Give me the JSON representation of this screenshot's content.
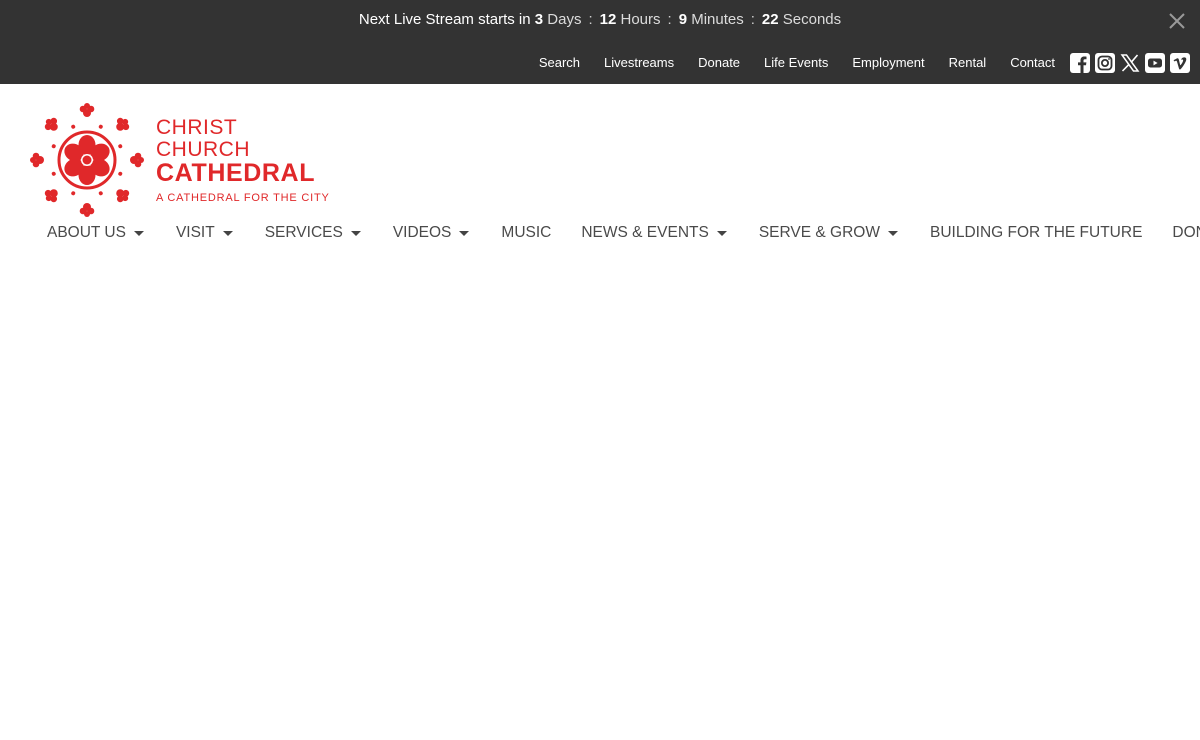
{
  "countdown": {
    "lead": "Next Live Stream starts in",
    "days": "3",
    "days_label": "Days",
    "hours": "12",
    "hours_label": "Hours",
    "minutes": "9",
    "minutes_label": "Minutes",
    "seconds": "22",
    "seconds_label": "Seconds",
    "separator": ":"
  },
  "utility_nav": [
    "Search",
    "Livestreams",
    "Donate",
    "Life Events",
    "Employment",
    "Rental",
    "Contact"
  ],
  "social_icons": [
    "facebook-icon",
    "instagram-icon",
    "x-icon",
    "youtube-icon",
    "vimeo-icon"
  ],
  "logo": {
    "line1": "CHRIST CHURCH",
    "line2": "CATHEDRAL",
    "line3": "A CATHEDRAL FOR THE CITY",
    "brand_color": "#e0282a"
  },
  "main_nav": [
    {
      "label": "ABOUT US",
      "dropdown": true
    },
    {
      "label": "VISIT",
      "dropdown": true
    },
    {
      "label": "SERVICES",
      "dropdown": true
    },
    {
      "label": "VIDEOS",
      "dropdown": true
    },
    {
      "label": "MUSIC",
      "dropdown": false
    },
    {
      "label": "NEWS & EVENTS",
      "dropdown": true
    },
    {
      "label": "SERVE & GROW",
      "dropdown": true
    },
    {
      "label": "BUILDING FOR THE FUTURE",
      "dropdown": false
    },
    {
      "label": "DONATE",
      "dropdown": false
    }
  ],
  "colors": {
    "topbar": "#333333",
    "brand": "#e0282a",
    "nav_text": "#4a4a4a"
  }
}
